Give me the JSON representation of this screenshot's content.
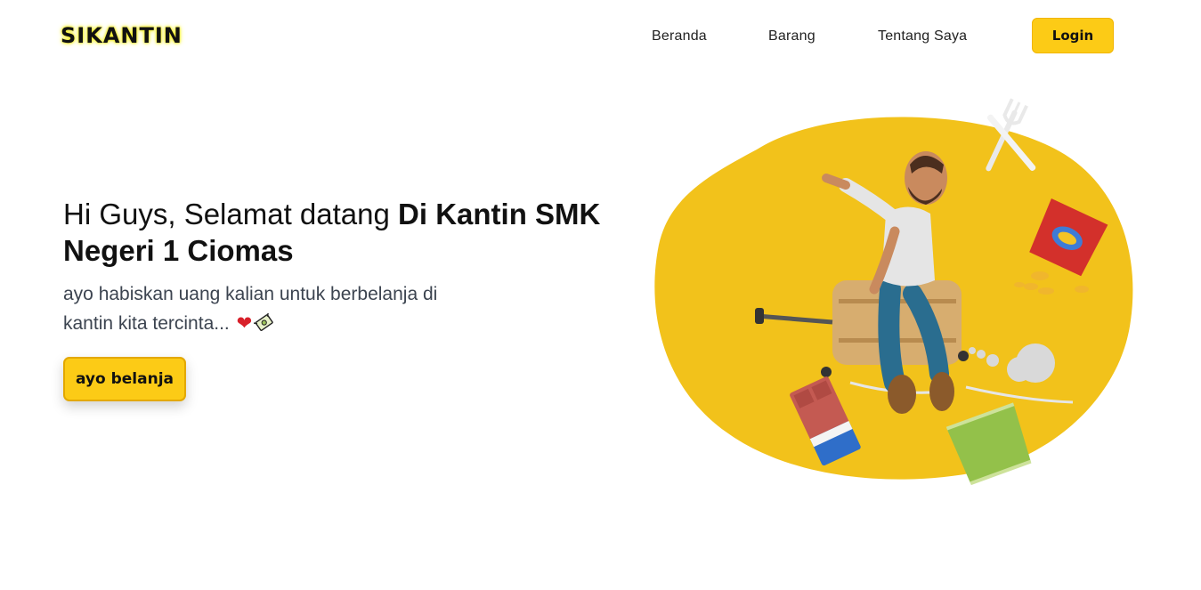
{
  "brand": {
    "logo": "SIKANTIN",
    "accent": "#fccb16",
    "logo_glow": "#f5ef2a"
  },
  "nav": {
    "items": [
      {
        "label": "Beranda"
      },
      {
        "label": "Barang"
      },
      {
        "label": "Tentang Saya"
      }
    ],
    "login_label": "Login"
  },
  "hero": {
    "title_prefix": "Hi Guys, Selamat datang ",
    "title_bold": "Di Kantin SMK Negeri 1 Ciomas",
    "description": "ayo habiskan uang kalian untuk berbelanja di kantin kita tercinta...",
    "emoji_heart": "❤",
    "cta_label": "ayo belanja"
  },
  "illustration": {
    "blob_color": "#f2c21b",
    "items": [
      "man-riding-suitcase",
      "fork-icon",
      "knife-icon",
      "chips-bag-red",
      "chocolate-bar",
      "chips-bag-green",
      "cloud-puffs"
    ]
  }
}
